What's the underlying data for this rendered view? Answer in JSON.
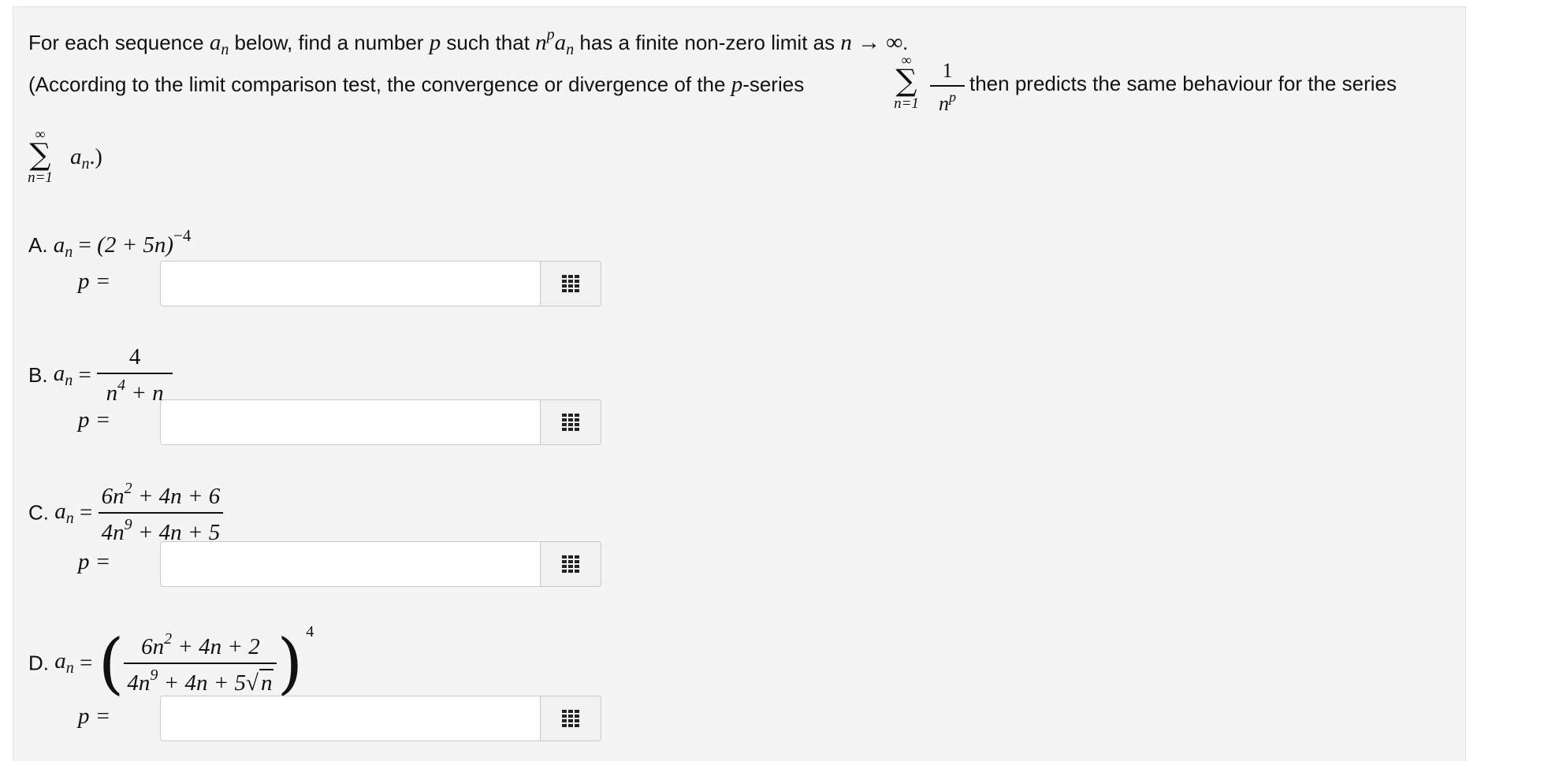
{
  "intro": {
    "l1_a": "For each sequence ",
    "l1_an_base": "a",
    "l1_an_sub": "n",
    "l1_b": " below, find a number ",
    "l1_p": "p",
    "l1_c": " such that ",
    "l1_n": "n",
    "l1_sup": "p",
    "l1_d": " has a finite non-zero limit as ",
    "l1_arrow": "n → ∞",
    "l1_e": ".",
    "l2_a": "(According to the limit comparison test, the convergence or divergence of the ",
    "l2_p": "p",
    "l2_b": "-series",
    "l2_sum_top": "∞",
    "l2_sum_sym": "∑",
    "l2_sum_bot": "n=1",
    "l2_frac_num": "1",
    "l2_frac_den_n": "n",
    "l2_frac_den_p": "p",
    "l2_c": " then predicts the same behaviour for the series",
    "l3_sum_top": "∞",
    "l3_sum_sym": "∑",
    "l3_sum_bot": "n=1",
    "l3_an_base": "a",
    "l3_an_sub": "n",
    "l3_end": ".)"
  },
  "problems": {
    "A": {
      "letter": "A. ",
      "an_base": "a",
      "an_sub": "n",
      "eq": " = ",
      "expr": "(2 + 5n)",
      "exp": "−4"
    },
    "B": {
      "letter": "B. ",
      "an_base": "a",
      "an_sub": "n",
      "eq": " = ",
      "num": "4",
      "den_a": "n",
      "den_sup": "4",
      "den_b": " + n"
    },
    "C": {
      "letter": "C. ",
      "an_base": "a",
      "an_sub": "n",
      "eq": " = ",
      "num_a": "6n",
      "num_sup": "2",
      "num_b": " + 4n + 6",
      "den_a": "4n",
      "den_sup": "9",
      "den_b": " + 4n + 5"
    },
    "D": {
      "letter": "D. ",
      "an_base": "a",
      "an_sub": "n",
      "eq": " = ",
      "lparen": "(",
      "rparen": ")",
      "num_a": "6n",
      "num_sup": "2",
      "num_b": " + 4n + 2",
      "den_a": "4n",
      "den_sup": "9",
      "den_b": " + 4n + 5",
      "sqrt_sym": "√",
      "sqrt_arg": "n",
      "exp": "4"
    }
  },
  "answers": {
    "p_label": "p =",
    "A": {
      "value": ""
    },
    "B": {
      "value": ""
    },
    "C": {
      "value": ""
    },
    "D": {
      "value": ""
    }
  },
  "icons": {
    "palette": "grid-palette-icon"
  },
  "colors": {
    "panel_bg": "#f4f4f4",
    "input_bg": "#ffffff",
    "border": "#c9c9c9",
    "icon": "#222222"
  }
}
